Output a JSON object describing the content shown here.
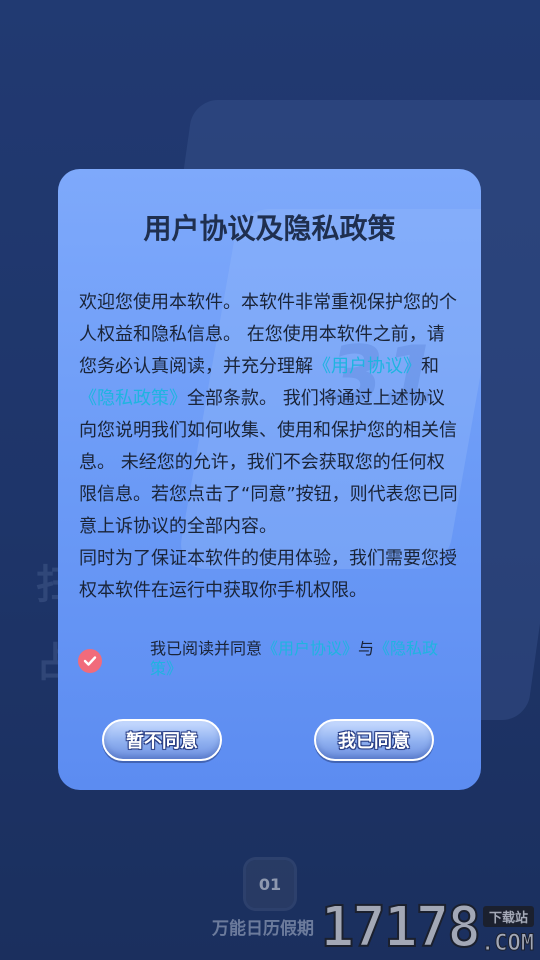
{
  "background": {
    "side_text_1": "扫",
    "side_text_2": "占",
    "app_icon_text": "01",
    "app_name": "万能日历假期",
    "watermark_number": "17178",
    "watermark_tag": "下载站",
    "watermark_com": ".COM"
  },
  "dialog": {
    "title": "用户协议及隐私政策",
    "body": {
      "p1_a": "欢迎您使用本软件。本软件非常重视保护您的个人权益和隐私信息。 在您使用本软件之前，请您务必认真阅读，并充分理解",
      "p1_link1": "《用户协议》",
      "p1_b": "和",
      "p1_link2": "《隐私政策》",
      "p1_c": "全部条款。 我们将通过上述协议向您说明我们如何收集、使用和保护您的相关信息。 未经您的允许，我们不会获取您的任何权限信息。若您点击了“同意”按钮，则代表您已同意上诉协议的全部内容。",
      "p2": " 同时为了保证本软件的使用体验，我们需要您授权本软件在运行中获取你手机权限。"
    },
    "agree": {
      "text_a": "我已阅读并同意",
      "link1": "《用户协议》",
      "text_b": "与",
      "link2": "《隐私政策》"
    },
    "buttons": {
      "disagree": "暂不同意",
      "agree": "我已同意"
    }
  },
  "colors": {
    "link": "#1fb4e0",
    "check": "#f16b7b",
    "dialog_top": "#7ea9fb",
    "dialog_bottom": "#5c8cf1"
  }
}
